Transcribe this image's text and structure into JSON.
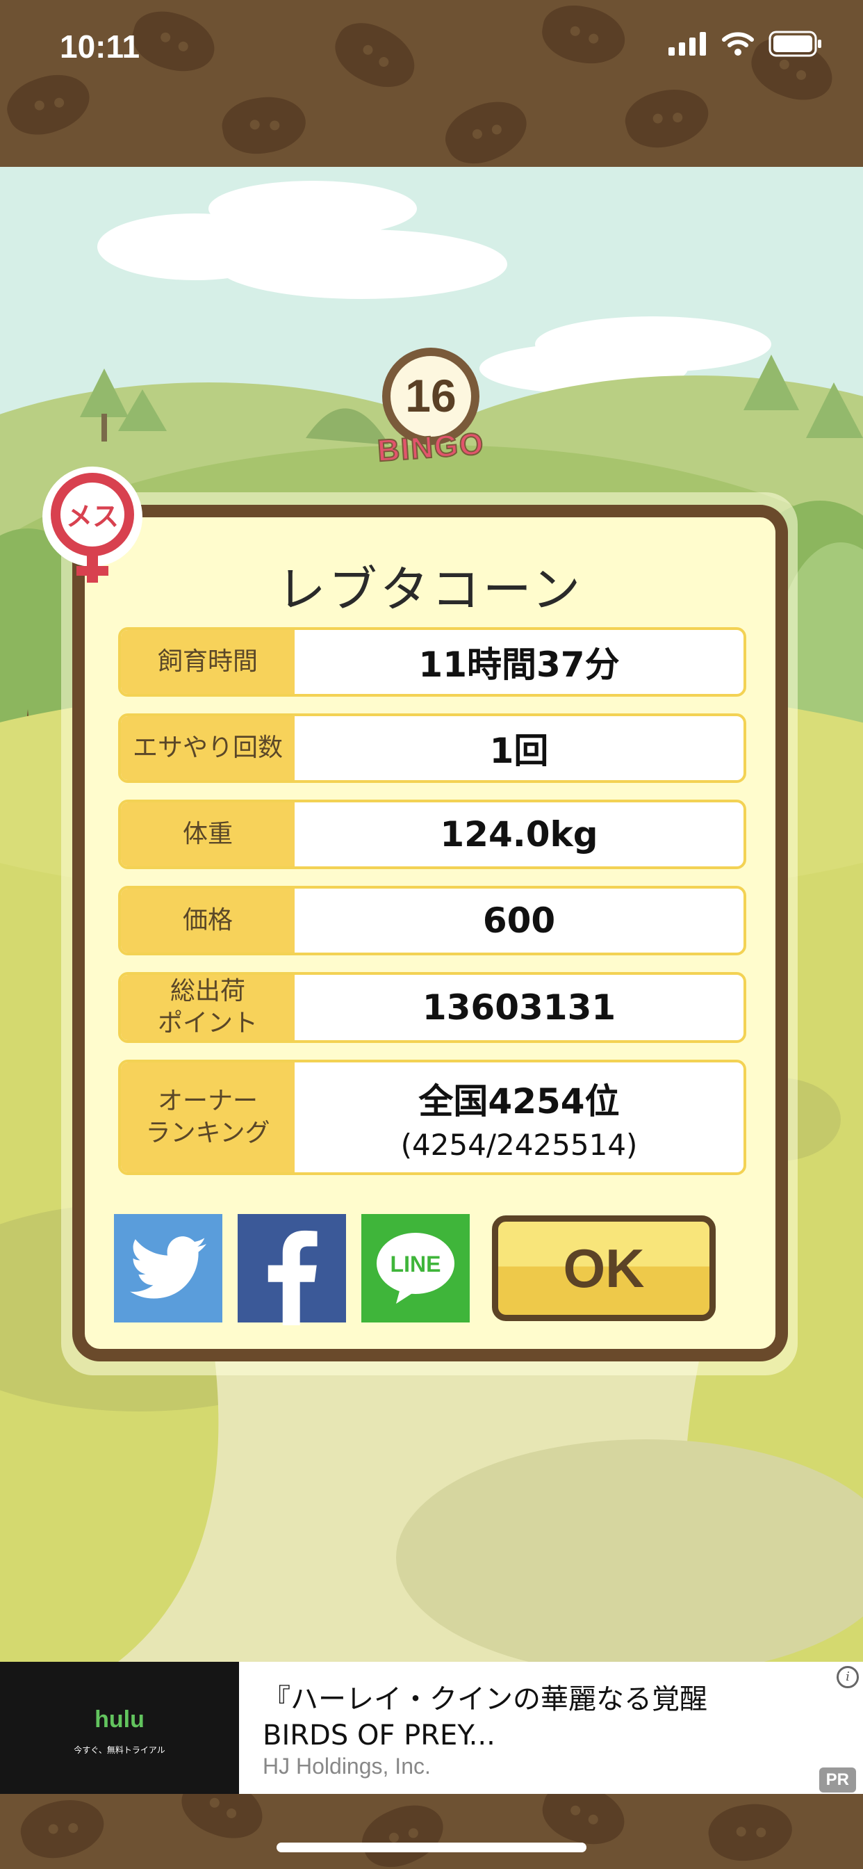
{
  "status_bar": {
    "time": "10:11"
  },
  "bingo": {
    "number": "16",
    "label": "BINGO"
  },
  "gender_badge": {
    "label": "メス"
  },
  "dialog": {
    "title": "レブタコーン",
    "stats": [
      {
        "label": "飼育時間",
        "value": "11時間37分"
      },
      {
        "label": "エサやり回数",
        "value": "1回"
      },
      {
        "label": "体重",
        "value": "124.0kg"
      },
      {
        "label": "価格",
        "value": "600"
      },
      {
        "label": "総出荷\nポイント",
        "value": "13603131"
      },
      {
        "label": "オーナー\nランキング",
        "value": "全国4254位",
        "sub": "(4254/2425514)"
      }
    ],
    "share": {
      "line_label": "LINE"
    },
    "ok_label": "OK",
    "colors": {
      "frame": "#6a4a2b",
      "panel": "#fffccd",
      "label_bg": "#f7d25a",
      "ok_top": "#f8e57a",
      "ok_bottom": "#eec94a"
    }
  },
  "ad": {
    "brand": "hulu",
    "brand_sub": "今すぐ、無料トライアル",
    "title_line1": "『ハーレイ・クインの華麗なる覚醒",
    "title_line2": "BIRDS OF PREY...",
    "source": "HJ Holdings, Inc.",
    "pr_label": "PR",
    "info_label": "i"
  }
}
